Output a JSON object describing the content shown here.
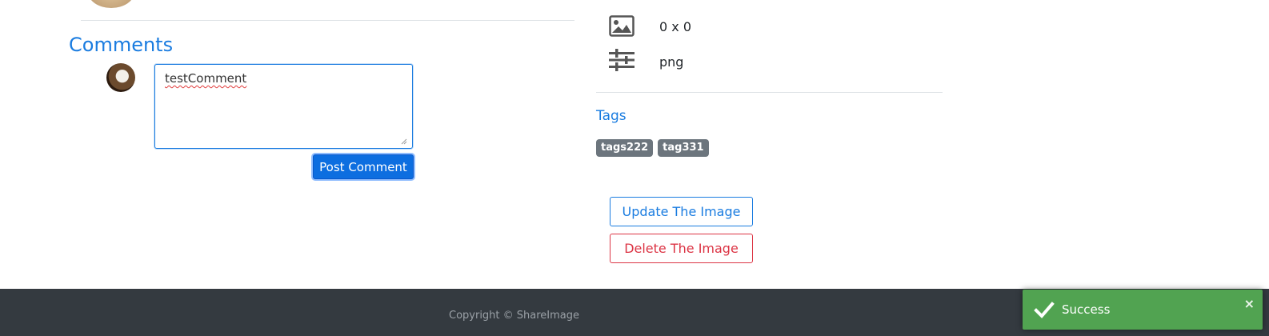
{
  "comments": {
    "title": "Comments",
    "input_value": "testComment",
    "post_button": "Post Comment"
  },
  "image_info": {
    "dimensions": "0 x 0",
    "format": "png"
  },
  "tags": {
    "title": "Tags",
    "items": [
      "tags222",
      "tag331"
    ]
  },
  "actions": {
    "update_label": "Update The Image",
    "delete_label": "Delete The Image"
  },
  "footer": {
    "copyright": "Copyright © ShareImage"
  },
  "toast": {
    "message": "Success",
    "close": "×"
  },
  "colors": {
    "accent": "#1a7ce0",
    "danger": "#dc3545",
    "success": "#51a351",
    "footer": "#343a40"
  },
  "icons": {
    "dimensions": "image-icon",
    "format": "sliders-icon",
    "toast": "checkmark-icon"
  }
}
